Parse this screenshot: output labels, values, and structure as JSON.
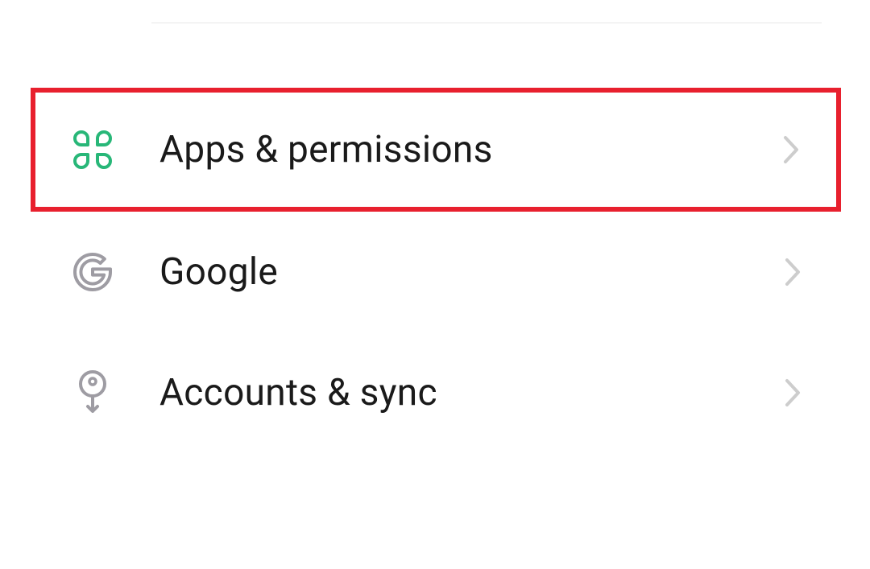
{
  "settings": {
    "items": [
      {
        "label": "Apps & permissions",
        "icon": "apps-grid-icon",
        "highlighted": true
      },
      {
        "label": "Google",
        "icon": "google-icon",
        "highlighted": false
      },
      {
        "label": "Accounts & sync",
        "icon": "key-icon",
        "highlighted": false
      }
    ]
  },
  "colors": {
    "highlight": "#e8202e",
    "iconGreen": "#28b778",
    "iconGray": "#9e9ca3",
    "chevron": "#cdcdcd",
    "text": "#1a1a1a"
  }
}
